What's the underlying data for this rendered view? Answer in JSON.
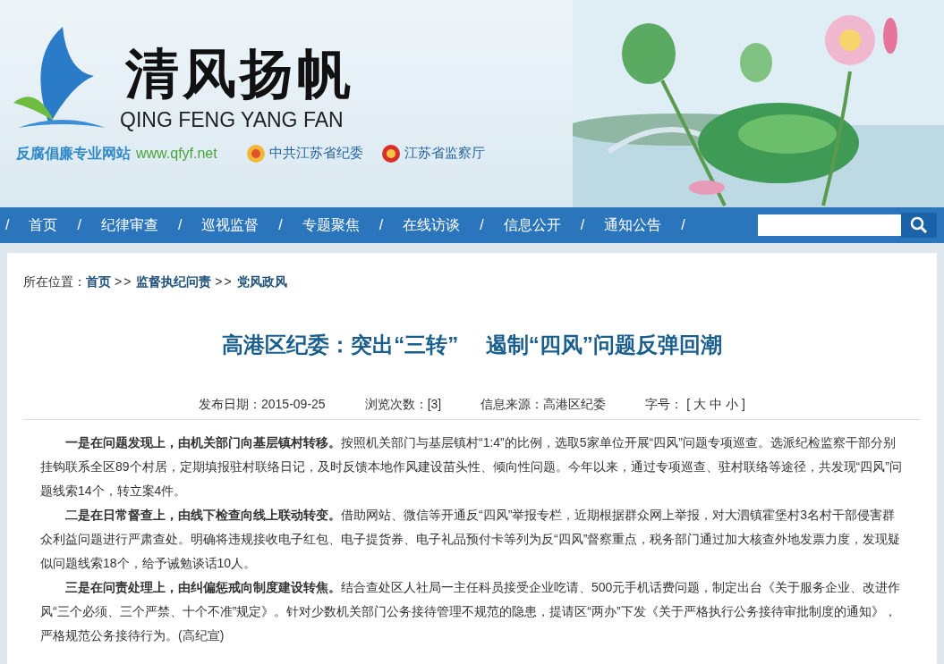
{
  "header": {
    "site_name": "清风扬帆",
    "site_name_pinyin": "QING FENG YANG FAN",
    "slogan": "反腐倡廉专业网站",
    "url": "www.qfyf.net",
    "affiliations": [
      "中共江苏省纪委",
      "江苏省监察厅"
    ]
  },
  "nav": {
    "separators": [
      "/",
      "/",
      "/",
      "/",
      "/",
      "/",
      "/",
      "/"
    ],
    "items": [
      {
        "label": "首页"
      },
      {
        "label": "纪律审查"
      },
      {
        "label": "巡视监督"
      },
      {
        "label": "专题聚焦"
      },
      {
        "label": "在线访谈"
      },
      {
        "label": "信息公开"
      },
      {
        "label": "通知公告"
      }
    ]
  },
  "breadcrumb": {
    "label": "所在位置：",
    "items": [
      "首页",
      "监督执纪问责",
      "党风政风"
    ],
    "separators": [
      ">>",
      ">>"
    ]
  },
  "article": {
    "title": "高港区纪委：突出“三转”　 遏制“四风”问题反弹回潮",
    "meta": [
      "发布日期：2015-09-25",
      "浏览次数：[3]",
      "信息来源：高港区纪委"
    ],
    "font_size": {
      "label": "字号：",
      "open": "[",
      "options": [
        "大",
        "中",
        "小"
      ],
      "close": "]"
    },
    "paragraphs": [
      "**一是在问题发现上，由机关部门向基层镇村转移。**按照机关部门与基层镇村“1:4”的比例，选取5家单位开展“四风”问题专项巡查。选派纪检监察干部分别挂钩联系全区89个村居，定期填报驻村联络日记，及时反馈本地作风建设苗头性、倾向性问题。今年以来，通过专项巡查、驻村联络等途径，共发现“四风”问题线索14个，转立案4件。",
      "**二是在日常督查上，由线下检查向线上联动转变。**借助网站、微信等开通反“四风”举报专栏，近期根据群众网上举报，对大泗镇霍堡村3名村干部侵害群众利益问题进行严肃查处。明确将违规接收电子红包、电子提货券、电子礼品预付卡等列为反“四风”督察重点，税务部门通过加大核查外地发票力度，发现疑似问题线索18个，给予诫勉谈话10人。",
      "**三是在问责处理上，由纠偏惩戒向制度建设转焦。**结合查处区人社局一主任科员接受企业吃请、500元手机话费问题，制定出台《关于服务企业、改进作风“三个必须、三个严禁、十个不准”规定》。针对少数机关部门公务接待管理不规范的隐患，提请区“两办”下发《关于严格执行公务接待审批制度的通知》，严格规范公务接待行为。(高纪宣)"
    ]
  }
}
